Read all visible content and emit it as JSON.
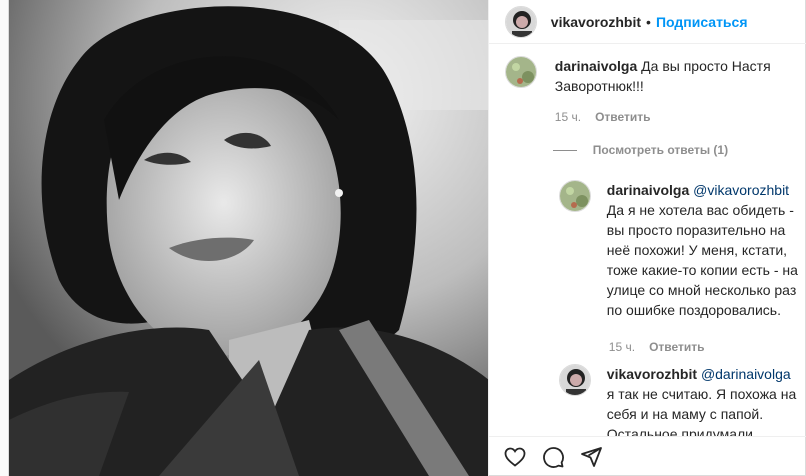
{
  "header": {
    "username": "vikavorozhbit",
    "separator": "•",
    "follow_label": "Подписаться"
  },
  "comments": [
    {
      "username": "darinaivolga",
      "text": "Да вы просто Настя Заворотнюк!!!",
      "time": "15 ч.",
      "reply_label": "Ответить"
    }
  ],
  "view_replies_label": "Посмотреть ответы (1)",
  "replies": [
    {
      "username": "darinaivolga",
      "mention": "@vikavorozhbit",
      "text": "Да я не хотела вас обидеть - вы просто поразительно на неё похожи! У меня, кстати, тоже какие-то копии есть - на улице со мной несколько раз по ошибке поздоровались.",
      "time": "15 ч.",
      "reply_label": "Ответить"
    },
    {
      "username": "vikavorozhbit",
      "mention": "@darinaivolga",
      "text": "я так не считаю. Я похожа на себя и на маму с папой. Остальное придумали"
    }
  ],
  "icons": [
    "heart-icon",
    "comment-icon",
    "share-icon"
  ],
  "colors": {
    "accent": "#0095f6",
    "muted": "#8e8e8e",
    "mention": "#00376b"
  }
}
